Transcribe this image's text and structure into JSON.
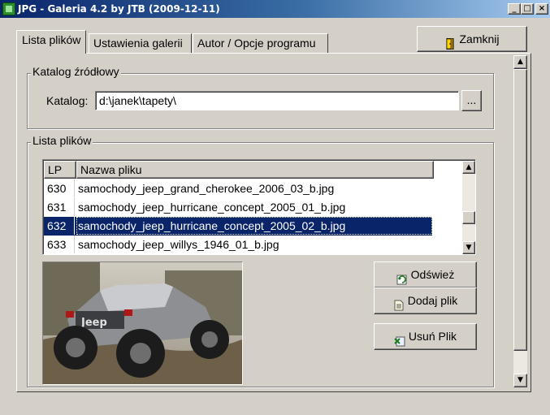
{
  "window": {
    "title": "JPG - Galeria 4.2 by JTB (2009-12-11)",
    "controls": {
      "minimize": "_",
      "maximize": "□",
      "close": "×"
    }
  },
  "tabs": [
    {
      "label": "Lista plików",
      "active": true
    },
    {
      "label": "Ustawienia galerii",
      "active": false
    },
    {
      "label": "Autor / Opcje programu",
      "active": false
    }
  ],
  "close_button": {
    "label": "Zamknij",
    "icon": "door-icon"
  },
  "source_group": {
    "title": "Katalog źródłowy",
    "field_label": "Katalog:",
    "field_value": "d:\\janek\\tapety\\",
    "browse_label": "..."
  },
  "files_group": {
    "title": "Lista plików",
    "columns": [
      "LP",
      "Nazwa pliku"
    ],
    "rows": [
      {
        "lp": "630",
        "name": "samochody_jeep_grand_cherokee_2006_03_b.jpg",
        "selected": false
      },
      {
        "lp": "631",
        "name": "samochody_jeep_hurricane_concept_2005_01_b.jpg",
        "selected": false
      },
      {
        "lp": "632",
        "name": "samochody_jeep_hurricane_concept_2005_02_b.jpg",
        "selected": true
      },
      {
        "lp": "633",
        "name": "samochody_jeep_willys_1946_01_b.jpg",
        "selected": false
      }
    ]
  },
  "preview": {
    "badge": "Jeep"
  },
  "actions": {
    "refresh": {
      "label": "Odśwież",
      "icon": "refresh-icon"
    },
    "add": {
      "label": "Dodaj plik",
      "icon": "add-file-icon"
    },
    "remove": {
      "label": "Usuń Plik",
      "icon": "delete-file-icon"
    }
  },
  "colors": {
    "title_bar": "#0a246a",
    "selection": "#0a246a",
    "face": "#d4d0c8"
  }
}
